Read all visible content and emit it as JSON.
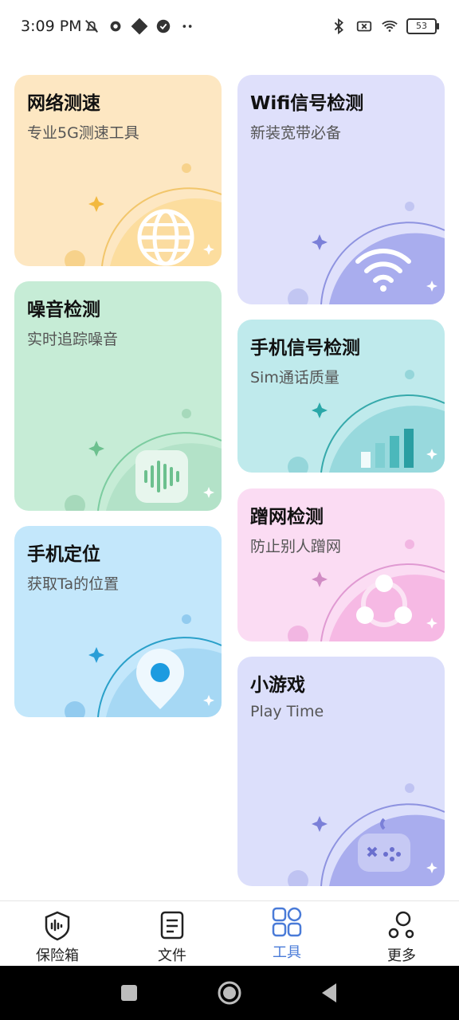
{
  "status_bar": {
    "time": "3:09 PM",
    "battery": "53",
    "icons_left": [
      "mute-bell-icon",
      "gear-icon",
      "app-icon",
      "check-circle-icon",
      "more-dots-icon"
    ],
    "icons_right": [
      "bluetooth-icon",
      "sim-off-icon",
      "wifi-icon",
      "battery-icon"
    ]
  },
  "cards": [
    {
      "id": "speed-test",
      "title": "网络测速",
      "subtitle": "专业5G测速工具",
      "color": "#fde7c2",
      "icon": "globe-icon"
    },
    {
      "id": "wifi-signal",
      "title": "Wifi信号检测",
      "subtitle": "新装宽带必备",
      "color": "#dfe0fb",
      "icon": "wifi-icon"
    },
    {
      "id": "noise",
      "title": "噪音检测",
      "subtitle": "实时追踪噪音",
      "color": "#c6ecd6",
      "icon": "soundwave-icon"
    },
    {
      "id": "phone-signal",
      "title": "手机信号检测",
      "subtitle": "Sim通话质量",
      "color": "#bfeaec",
      "icon": "signal-bars-icon"
    },
    {
      "id": "phone-locate",
      "title": "手机定位",
      "subtitle": "获取Ta的位置",
      "color": "#c3e7fb",
      "icon": "location-pin-icon"
    },
    {
      "id": "freeloader",
      "title": "蹭网检测",
      "subtitle": "防止别人蹭网",
      "color": "#fbdcf3",
      "icon": "share-nodes-icon"
    },
    {
      "id": "mini-game",
      "title": "小游戏",
      "subtitle": "Play Time",
      "color": "#dcdffb",
      "icon": "gamepad-icon"
    }
  ],
  "bottom_nav": {
    "items": [
      {
        "label": "保险箱",
        "icon": "shield-icon",
        "active": false
      },
      {
        "label": "文件",
        "icon": "document-icon",
        "active": false
      },
      {
        "label": "工具",
        "icon": "grid-icon",
        "active": true
      },
      {
        "label": "更多",
        "icon": "more-circles-icon",
        "active": false
      }
    ],
    "active_color": "#4a7bd8"
  },
  "system_nav": [
    "recents-square-icon",
    "home-circle-icon",
    "back-triangle-icon"
  ]
}
